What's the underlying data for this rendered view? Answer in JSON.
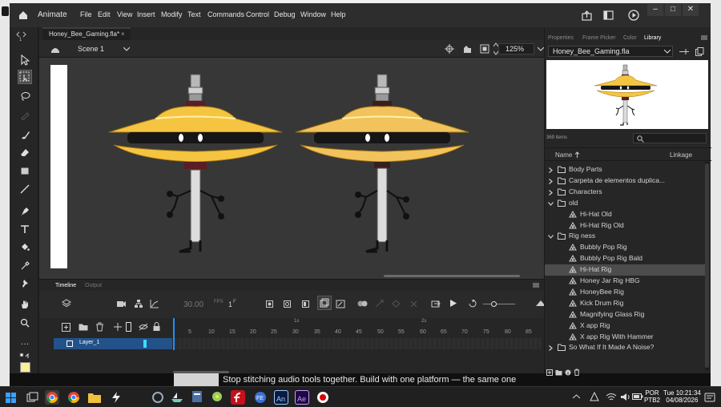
{
  "window": {
    "app_name": "Animate",
    "menu": [
      "File",
      "Edit",
      "View",
      "Insert",
      "Modify",
      "Text",
      "Commands",
      "Control",
      "Debug",
      "Window",
      "Help"
    ],
    "controls": [
      "–",
      "□",
      "✕"
    ]
  },
  "document": {
    "tab_title": "Honey_Bee_Gaming.fla*",
    "tab_close": "×",
    "scene_label": "Scene 1",
    "zoom": "125%"
  },
  "tools": [
    "arrow",
    "free-transform",
    "lasso",
    "pen-alt",
    "brush",
    "eraser",
    "rectangle",
    "line",
    "pen",
    "text",
    "paint-bucket",
    "eyedropper",
    "pin",
    "hand",
    "zoom",
    "more"
  ],
  "timeline": {
    "tab_active": "Timeline",
    "tab_other": "Output",
    "fps_value": "30.00",
    "fps_unit": "FPS",
    "frame_value": "1",
    "frame_unit": "F",
    "ruler_ticks": [
      "5",
      "10",
      "15",
      "20",
      "25",
      "30",
      "35",
      "40",
      "45",
      "50",
      "55",
      "60",
      "65",
      "70",
      "75",
      "80",
      "85"
    ],
    "second_marks": [
      "1s",
      "2s"
    ],
    "layer_name": "Layer_1"
  },
  "right_panel": {
    "tabs": [
      "Properties",
      "Frame Picker",
      "Color",
      "Library"
    ],
    "active_tab": "Library",
    "library_file": "Honey_Bee_Gaming.fla",
    "item_count": "369 items",
    "col_name": "Name",
    "col_linkage": "Linkage",
    "items": [
      {
        "label": "Body Parts",
        "type": "folder",
        "expanded": false,
        "indent": 0
      },
      {
        "label": "Carpeta de elementos duplica...",
        "type": "folder",
        "expanded": false,
        "indent": 0
      },
      {
        "label": "Characters",
        "type": "folder",
        "expanded": false,
        "indent": 0
      },
      {
        "label": "old",
        "type": "folder",
        "expanded": true,
        "indent": 0
      },
      {
        "label": "Hi-Hat Old",
        "type": "symbol",
        "indent": 1
      },
      {
        "label": "Hi-Hat Rig Old",
        "type": "symbol",
        "indent": 1
      },
      {
        "label": "Rig ness",
        "type": "folder",
        "expanded": true,
        "indent": 0
      },
      {
        "label": "Bubbly Pop Rig",
        "type": "symbol",
        "indent": 1
      },
      {
        "label": "Bubbly Pop Rig Bald",
        "type": "symbol",
        "indent": 1
      },
      {
        "label": "Hi-Hat Rig",
        "type": "symbol",
        "indent": 1,
        "selected": true
      },
      {
        "label": "Honey Jar Rig HBG",
        "type": "symbol",
        "indent": 1
      },
      {
        "label": "HoneyBee Rig",
        "type": "symbol",
        "indent": 1
      },
      {
        "label": "Kick Drum Rig",
        "type": "symbol",
        "indent": 1
      },
      {
        "label": "Magnifying Glass Rig",
        "type": "symbol",
        "indent": 1
      },
      {
        "label": "X app Rig",
        "type": "symbol",
        "indent": 1
      },
      {
        "label": "X app Rig With Hammer",
        "type": "symbol",
        "indent": 1
      },
      {
        "label": "So What If It Made A Noise?",
        "type": "folder",
        "expanded": false,
        "indent": 0
      }
    ]
  },
  "background": {
    "caption": "Stop stitching audio tools together. Build with one platform — the same one"
  },
  "taskbar": {
    "lang_top": "POR",
    "lang_bottom": "PTB2",
    "day_time": "Tue  10:21:34",
    "date": "04/08/2026",
    "apps": [
      "start",
      "task-view",
      "chrome",
      "chrome-alt",
      "file-explorer",
      "winamp-like",
      "app-7",
      "app-8",
      "app-9",
      "app-10",
      "app-11",
      "app-12",
      "animate",
      "after-effects",
      "record"
    ]
  },
  "colors": {
    "accent_blue": "#23528a",
    "playhead": "#1f8fff",
    "cymbal_gold": "#f5c542",
    "layer_cyan": "#3ed9ff"
  }
}
